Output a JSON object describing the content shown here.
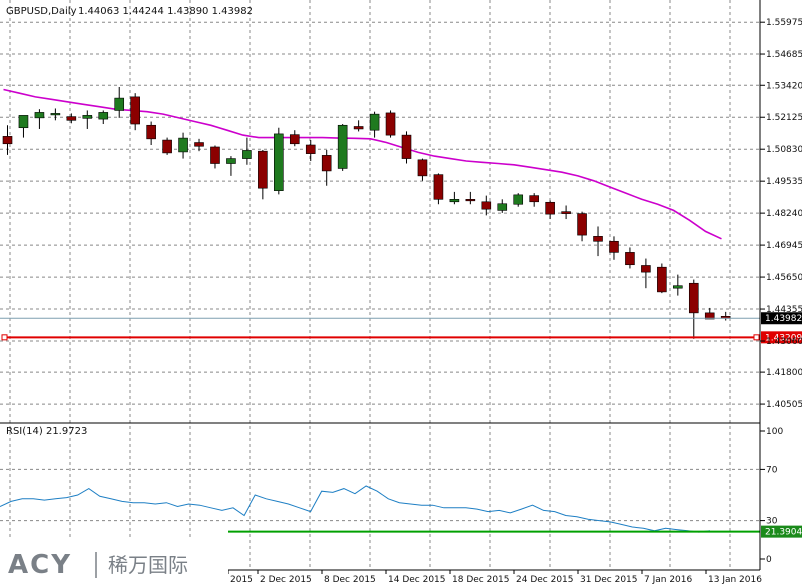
{
  "colors": {
    "up": "#1f7a1f",
    "down": "#8b0000",
    "ma": "#cc00cc",
    "rsi": "#1e7fc4",
    "last_price_line": "#7f9fb0",
    "support": "#e00000",
    "rsi_level": "#00a000",
    "grid": "#888888",
    "tag_dark": "#000000",
    "tag_red": "#e00000",
    "tag_green": "#1a8a1a",
    "logo": "#7a8087"
  },
  "header": {
    "symbol": "GBPUSD,Daily",
    "ohlc": "1.44063 1.44244 1.43890 1.43982"
  },
  "logo": {
    "brand": "ACY",
    "chinese": "稀万国际"
  },
  "price_axis": {
    "ticks": [
      "1.55975",
      "1.54685",
      "1.53420",
      "1.52125",
      "1.50830",
      "1.49535",
      "1.48240",
      "1.46945",
      "1.45650",
      "1.44355",
      "1.43060",
      "1.41800",
      "1.40505"
    ],
    "last_price": "1.43982",
    "support_price": "1.43209"
  },
  "rsi_panel": {
    "label": "RSI(14) 21.9723",
    "ticks": [
      "100",
      "70",
      "30",
      "0"
    ],
    "level_value": "21.3904"
  },
  "date_axis": {
    "labels": [
      "2015",
      "2 Dec 2015",
      "8 Dec 2015",
      "14 Dec 2015",
      "18 Dec 2015",
      "24 Dec 2015",
      "31 Dec 2015",
      "7 Jan 2016",
      "13 Jan 2016"
    ]
  },
  "chart_data": {
    "type": "candlestick",
    "symbol": "GBPUSD",
    "timeframe": "Daily",
    "y_range": [
      1.3986,
      1.5655
    ],
    "candles": [
      {
        "o": 1.5135,
        "h": 1.518,
        "l": 1.506,
        "c": 1.5105
      },
      {
        "o": 1.517,
        "h": 1.5215,
        "l": 1.513,
        "c": 1.522
      },
      {
        "o": 1.521,
        "h": 1.5245,
        "l": 1.5165,
        "c": 1.5232
      },
      {
        "o": 1.5225,
        "h": 1.5248,
        "l": 1.52,
        "c": 1.5228
      },
      {
        "o": 1.5215,
        "h": 1.5228,
        "l": 1.5188,
        "c": 1.52
      },
      {
        "o": 1.5208,
        "h": 1.524,
        "l": 1.5165,
        "c": 1.522
      },
      {
        "o": 1.5205,
        "h": 1.524,
        "l": 1.5185,
        "c": 1.5232
      },
      {
        "o": 1.524,
        "h": 1.5335,
        "l": 1.521,
        "c": 1.529
      },
      {
        "o": 1.5295,
        "h": 1.531,
        "l": 1.516,
        "c": 1.5185
      },
      {
        "o": 1.518,
        "h": 1.5195,
        "l": 1.51,
        "c": 1.5125
      },
      {
        "o": 1.512,
        "h": 1.513,
        "l": 1.506,
        "c": 1.5068
      },
      {
        "o": 1.5072,
        "h": 1.515,
        "l": 1.5045,
        "c": 1.5128
      },
      {
        "o": 1.511,
        "h": 1.5125,
        "l": 1.5075,
        "c": 1.5095
      },
      {
        "o": 1.5092,
        "h": 1.5098,
        "l": 1.5005,
        "c": 1.5025
      },
      {
        "o": 1.5025,
        "h": 1.5055,
        "l": 1.4975,
        "c": 1.5045
      },
      {
        "o": 1.5045,
        "h": 1.513,
        "l": 1.502,
        "c": 1.5078
      },
      {
        "o": 1.5075,
        "h": 1.508,
        "l": 1.488,
        "c": 1.4925
      },
      {
        "o": 1.4915,
        "h": 1.517,
        "l": 1.49,
        "c": 1.5145
      },
      {
        "o": 1.5142,
        "h": 1.516,
        "l": 1.5095,
        "c": 1.5105
      },
      {
        "o": 1.51,
        "h": 1.512,
        "l": 1.5035,
        "c": 1.5065
      },
      {
        "o": 1.5058,
        "h": 1.508,
        "l": 1.4935,
        "c": 1.4995
      },
      {
        "o": 1.5005,
        "h": 1.5185,
        "l": 1.4995,
        "c": 1.518
      },
      {
        "o": 1.5175,
        "h": 1.52,
        "l": 1.5155,
        "c": 1.5165
      },
      {
        "o": 1.516,
        "h": 1.5235,
        "l": 1.513,
        "c": 1.5225
      },
      {
        "o": 1.523,
        "h": 1.524,
        "l": 1.513,
        "c": 1.514
      },
      {
        "o": 1.514,
        "h": 1.5155,
        "l": 1.5025,
        "c": 1.5045
      },
      {
        "o": 1.504,
        "h": 1.5045,
        "l": 1.4955,
        "c": 1.4975
      },
      {
        "o": 1.498,
        "h": 1.4985,
        "l": 1.486,
        "c": 1.488
      },
      {
        "o": 1.487,
        "h": 1.491,
        "l": 1.486,
        "c": 1.488
      },
      {
        "o": 1.488,
        "h": 1.491,
        "l": 1.486,
        "c": 1.4875
      },
      {
        "o": 1.487,
        "h": 1.4895,
        "l": 1.4815,
        "c": 1.484
      },
      {
        "o": 1.4835,
        "h": 1.488,
        "l": 1.4825,
        "c": 1.4862
      },
      {
        "o": 1.486,
        "h": 1.4905,
        "l": 1.485,
        "c": 1.4898
      },
      {
        "o": 1.4895,
        "h": 1.4905,
        "l": 1.485,
        "c": 1.487
      },
      {
        "o": 1.4868,
        "h": 1.4875,
        "l": 1.48,
        "c": 1.482
      },
      {
        "o": 1.483,
        "h": 1.4855,
        "l": 1.48,
        "c": 1.4822
      },
      {
        "o": 1.4822,
        "h": 1.483,
        "l": 1.471,
        "c": 1.4735
      },
      {
        "o": 1.473,
        "h": 1.477,
        "l": 1.465,
        "c": 1.471
      },
      {
        "o": 1.471,
        "h": 1.473,
        "l": 1.4635,
        "c": 1.4665
      },
      {
        "o": 1.4665,
        "h": 1.4685,
        "l": 1.46,
        "c": 1.4615
      },
      {
        "o": 1.4612,
        "h": 1.464,
        "l": 1.452,
        "c": 1.4585
      },
      {
        "o": 1.4605,
        "h": 1.462,
        "l": 1.45,
        "c": 1.4505
      },
      {
        "o": 1.452,
        "h": 1.4575,
        "l": 1.449,
        "c": 1.453
      },
      {
        "o": 1.454,
        "h": 1.4555,
        "l": 1.4315,
        "c": 1.442
      },
      {
        "o": 1.442,
        "h": 1.444,
        "l": 1.4395,
        "c": 1.4395
      },
      {
        "o": 1.4406,
        "h": 1.4424,
        "l": 1.4389,
        "c": 1.4398
      }
    ],
    "ma_values": [
      1.5325,
      1.531,
      1.5295,
      1.5285,
      1.5275,
      1.5265,
      1.5255,
      1.5245,
      1.524,
      1.5235,
      1.5225,
      1.521,
      1.5195,
      1.518,
      1.516,
      1.514,
      1.513,
      1.513,
      1.513,
      1.513,
      1.513,
      1.5128,
      1.5127,
      1.5125,
      1.511,
      1.509,
      1.507,
      1.5055,
      1.5045,
      1.5035,
      1.503,
      1.5025,
      1.502,
      1.501,
      1.5,
      1.499,
      1.4975,
      1.4955,
      1.493,
      1.4905,
      1.488,
      1.486,
      1.4835,
      1.4795,
      1.475,
      1.472
    ],
    "rsi_values": [
      41,
      45,
      47,
      47,
      46,
      47,
      48,
      50,
      55,
      49,
      47,
      45,
      44,
      44,
      43,
      44,
      41,
      43,
      42,
      40,
      38,
      40,
      34,
      50,
      47,
      45,
      43,
      40,
      37,
      53,
      52,
      55,
      51,
      57,
      53,
      47,
      44,
      43,
      42,
      42,
      40,
      40,
      40,
      39,
      37,
      38,
      36,
      39,
      42,
      38,
      37,
      34,
      33,
      31,
      30,
      29,
      27,
      25,
      24,
      22,
      24,
      23,
      22,
      21,
      22
    ],
    "rsi_range": [
      0,
      100
    ],
    "rsi_levels": [
      70,
      30
    ],
    "support_level": 1.43209,
    "last_price": 1.43982
  }
}
